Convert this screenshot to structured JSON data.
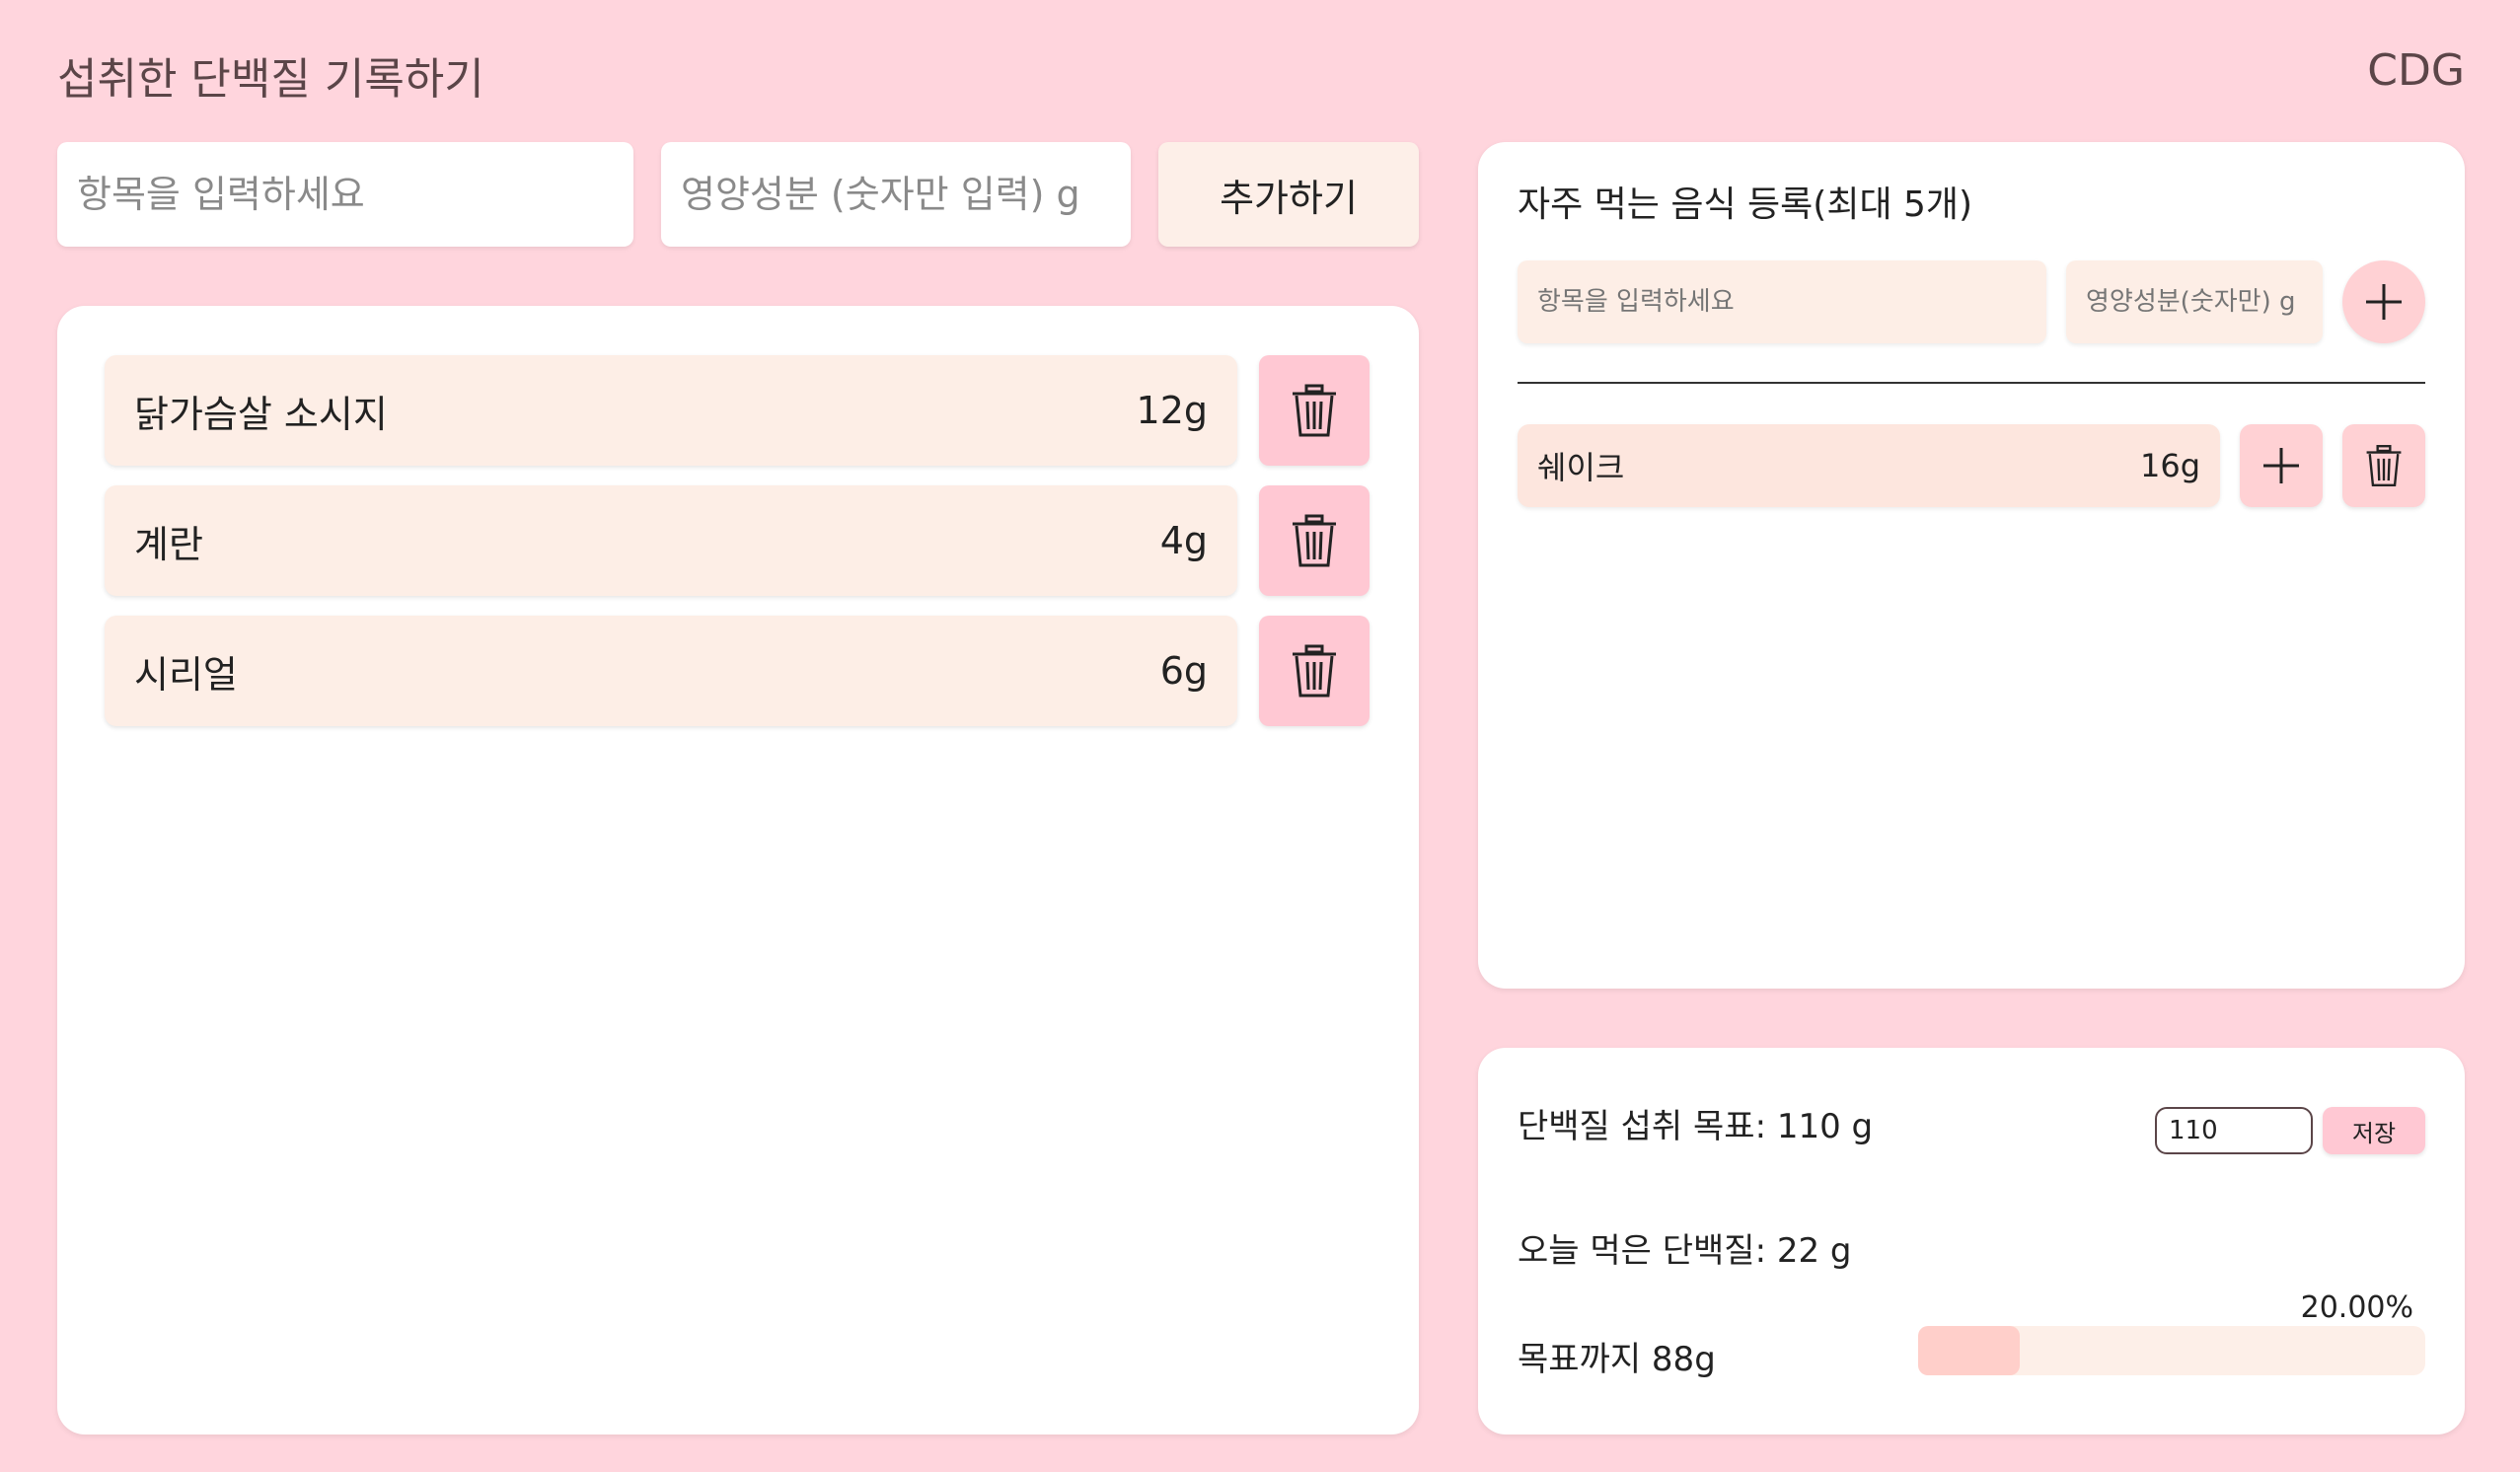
{
  "header": {
    "title": "섭취한 단백질 기록하기",
    "logo": "CDG"
  },
  "entry_form": {
    "item_placeholder": "항목을 입력하세요",
    "protein_placeholder": "영양성분 (숫자만 입력) g",
    "add_label": "추가하기"
  },
  "intake_list": [
    {
      "name": "닭가슴살 소시지",
      "amount": "12g"
    },
    {
      "name": "계란",
      "amount": "4g"
    },
    {
      "name": "시리얼",
      "amount": "6g"
    }
  ],
  "favorites": {
    "title": "자주 먹는 음식 등록(최대 5개)",
    "item_placeholder": "항목을 입력하세요",
    "protein_placeholder": "영양성분(숫자만) g",
    "items": [
      {
        "name": "쉐이크",
        "amount": "16g"
      }
    ]
  },
  "goal": {
    "goal_label": "단백질 섭취 목표: 110 g",
    "goal_input_value": "110",
    "save_label": "저장",
    "eaten_label": "오늘 먹은 단백질: 22 g",
    "remaining_label": "목표까지 88g",
    "progress_text": "20.00%",
    "progress_fraction": 0.2
  },
  "colors": {
    "background": "#ffd5dd",
    "accent": "#ffc8d3",
    "row": "#fdeee6"
  }
}
